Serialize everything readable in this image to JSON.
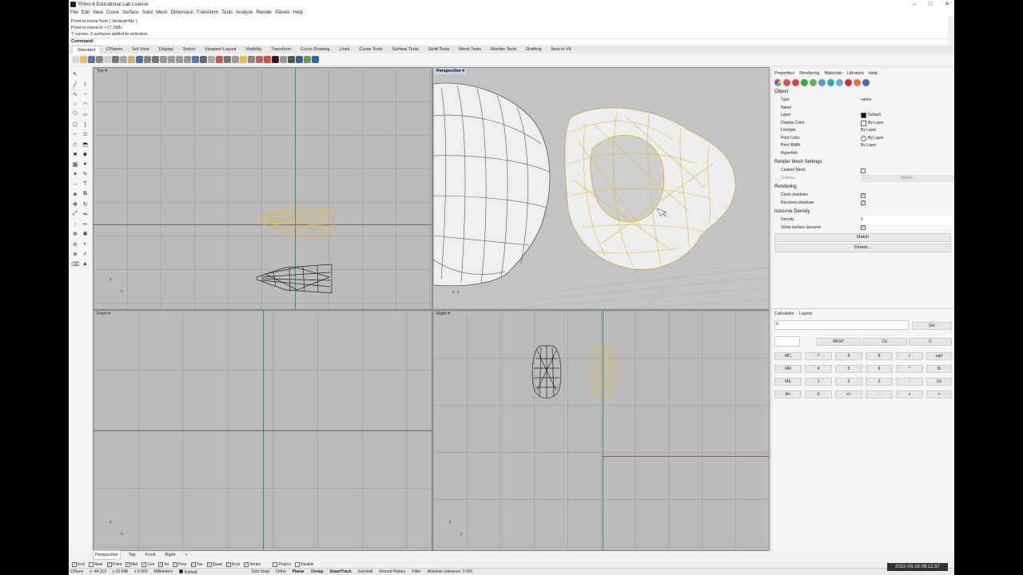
{
  "window": {
    "title": "Rhino 6 Educational Lab License",
    "controls": [
      "–",
      "□",
      "✕"
    ]
  },
  "menu": [
    "File",
    "Edit",
    "View",
    "Curve",
    "Surface",
    "Solid",
    "Mesh",
    "Dimension",
    "Transform",
    "Tools",
    "Analyze",
    "Render",
    "Panels",
    "Help"
  ],
  "command_history": [
    "Point to move from ( Vertical=No )",
    "Point to move to <17.168>",
    "7 curves, 3 surfaces added to selection."
  ],
  "command_prompt": "Command:",
  "toolbar_tabs": [
    "Standard",
    "CPlanes",
    "Set View",
    "Display",
    "Select",
    "Viewport Layout",
    "Visibility",
    "Transform",
    "Curve Drawing",
    "Lines",
    "Curve Tools",
    "Surface Tools",
    "Solid Tools",
    "Mesh Tools",
    "Render Tools",
    "Drafting",
    "New in V6"
  ],
  "active_toolbar_tab": "Standard",
  "viewports": {
    "top": {
      "label": "Top",
      "axis_x": "x",
      "axis_y": "y"
    },
    "perspective": {
      "label": "Perspective",
      "axis_x": "x",
      "axis_y": "y"
    },
    "front": {
      "label": "Front",
      "axis_x": "x",
      "axis_y": "z"
    },
    "right": {
      "label": "Right",
      "axis_x": "y",
      "axis_y": "z"
    }
  },
  "panel_tabs": [
    "Properties",
    "Rendering",
    "Materials",
    "Libraries",
    "Help"
  ],
  "properties": {
    "object_header": "Object",
    "rows": [
      {
        "key": "Type",
        "value": "varies"
      },
      {
        "key": "Name",
        "value": ""
      },
      {
        "key": "Layer",
        "value": "Default"
      },
      {
        "key": "Display Color",
        "value": "By Layer"
      },
      {
        "key": "Linetype",
        "value": "By Layer"
      },
      {
        "key": "Print Color",
        "value": "By Layer"
      },
      {
        "key": "Print Width",
        "value": "By Layer"
      },
      {
        "key": "Hyperlink",
        "value": ""
      }
    ],
    "render_mesh_header": "Render Mesh Settings",
    "custom_mesh": "Custom Mesh",
    "settings": "Settings",
    "adjust": "Adjust...",
    "rendering_header": "Rendering",
    "casts_shadows": "Casts shadows",
    "receives_shadows": "Receives shadows",
    "isocurve_header": "Isocurve Density",
    "density_label": "Density",
    "density_value": "1",
    "show_isocurve": "Show surface isocurve",
    "match_button": "Match",
    "details_button": "Details..."
  },
  "calc_tabs": [
    "Calculator",
    "Layers"
  ],
  "calculator": {
    "display": "0.",
    "go": "Go",
    "top_row": [
      "BKSP",
      "CE",
      "C"
    ],
    "rows": [
      [
        "MC",
        "7",
        "8",
        "9",
        "/",
        "sqrt"
      ],
      [
        "MR",
        "4",
        "5",
        "6",
        "*",
        "%"
      ],
      [
        "MS",
        "1",
        "2",
        "3",
        "-",
        "1/x"
      ],
      [
        "M+",
        "0",
        "+/-",
        ".",
        "+",
        "="
      ]
    ]
  },
  "view_tabs": [
    "Perspective",
    "Top",
    "Front",
    "Right"
  ],
  "osnaps": [
    {
      "label": "End",
      "checked": true
    },
    {
      "label": "Near",
      "checked": false
    },
    {
      "label": "Point",
      "checked": true
    },
    {
      "label": "Mid",
      "checked": true
    },
    {
      "label": "Cen",
      "checked": true
    },
    {
      "label": "Int",
      "checked": true
    },
    {
      "label": "Perp",
      "checked": true
    },
    {
      "label": "Tan",
      "checked": true
    },
    {
      "label": "Quad",
      "checked": true
    },
    {
      "label": "Knot",
      "checked": true
    },
    {
      "label": "Vertex",
      "checked": true
    },
    {
      "label": "Project",
      "checked": false
    },
    {
      "label": "Disable",
      "checked": false
    }
  ],
  "status": {
    "cplane": "CPlane",
    "x": "x -44.113",
    "y": "y 22.648",
    "z": "z 0.000",
    "units": "Millimeters",
    "layer": "Default",
    "grid_snap": "Grid Snap",
    "ortho": "Ortho",
    "planar": "Planar",
    "osnap": "Osnap",
    "smarttrack": "SmartTrack",
    "gumball": "Gumball",
    "record_history": "Record History",
    "filter": "Filter",
    "tolerance": "Absolute tolerance: 0.001"
  },
  "clock": "2022-03-18  09:12:37"
}
